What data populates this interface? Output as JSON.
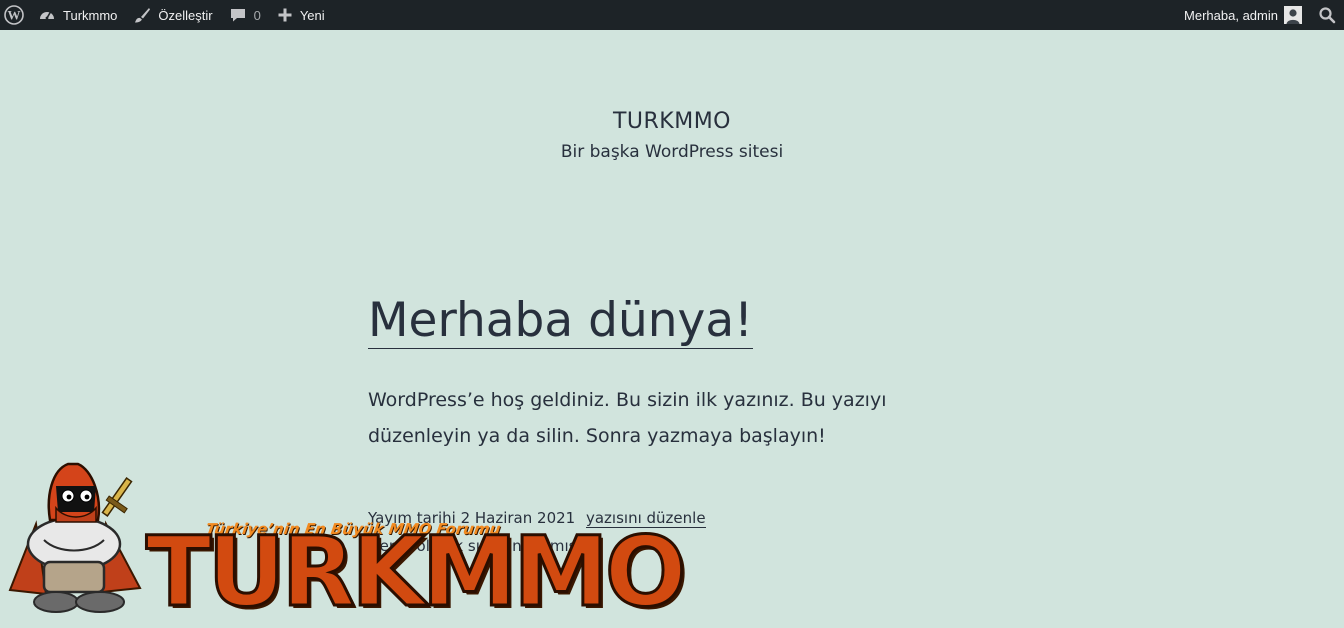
{
  "adminbar": {
    "site_name": "Turkmmo",
    "customize_label": "Özelleştir",
    "comments_count": "0",
    "new_label": "Yeni",
    "greeting": "Merhaba, admin",
    "icons": {
      "wordpress": "wordpress-icon",
      "dashboard": "dashboard-icon",
      "customize": "brush-icon",
      "comments": "comment-icon",
      "new": "plus-icon",
      "avatar": "avatar-icon",
      "search": "search-icon"
    }
  },
  "site": {
    "title": "TURKMMO",
    "tagline": "Bir başka WordPress sitesi"
  },
  "post": {
    "title": "Merhaba dünya!",
    "content": "WordPress’e hoş geldiniz. Bu sizin ilk yazınız. Bu yazıyı düzenleyin ya da silin. Sonra yazmaya başlayın!",
    "published_label": "Yayım tarihi 2 Haziran 2021",
    "edit_label": "yazısını düzenle",
    "category_label": "Genel olarak sınıflandırılmış"
  },
  "watermark": {
    "tagline": "Türkiye’nin En Büyük MMO Forumu",
    "logo_text": "TURKMMO"
  },
  "colors": {
    "adminbar_bg": "#1d2327",
    "page_bg": "#d1e4dd",
    "text": "#28303d",
    "logo_orange": "#d24a10"
  }
}
